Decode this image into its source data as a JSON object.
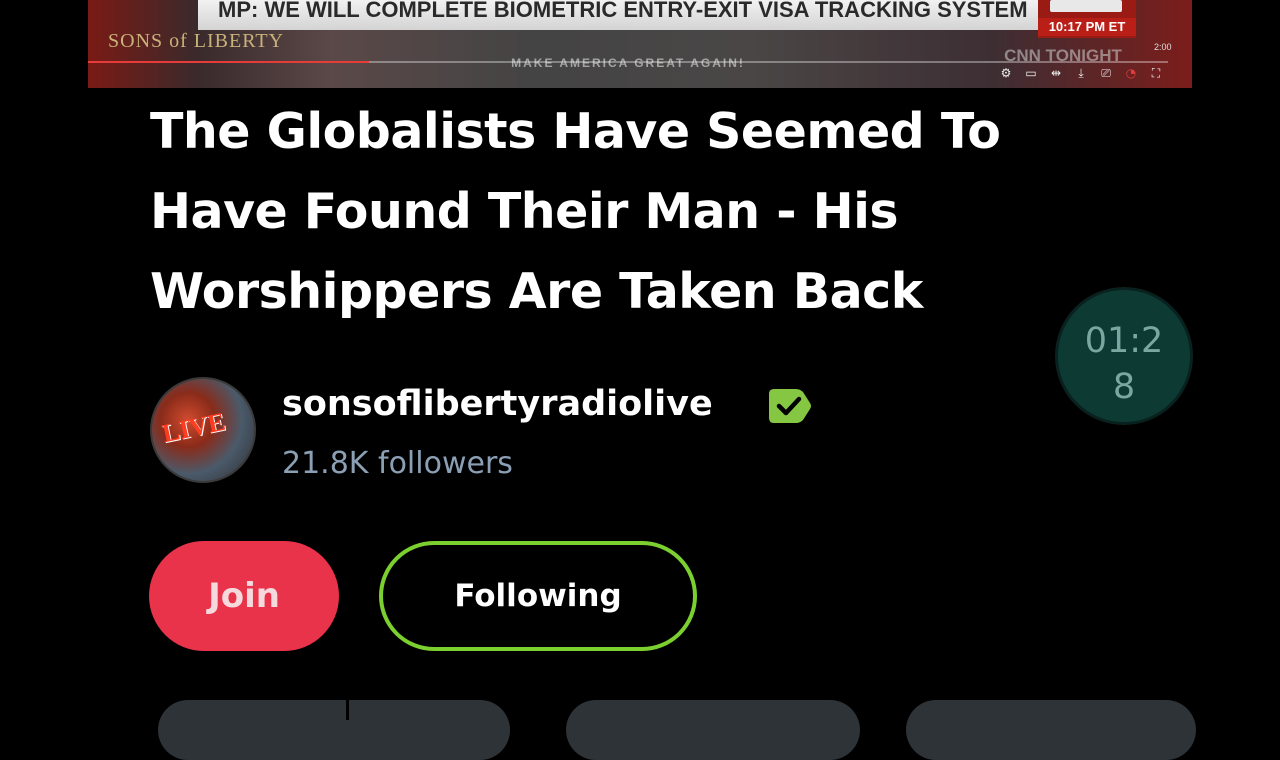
{
  "video": {
    "banner_text": "MP: WE WILL COMPLETE BIOMETRIC ENTRY-EXIT VISA TRACKING SYSTEM",
    "timestamp": "10:17 PM ET",
    "show_name": "CNN TONIGHT",
    "podium_text": "MAKE AMERICA GREAT AGAIN!",
    "channel_logo": "SONS of LIBERTY",
    "duration": "2:00",
    "progress": 0.26
  },
  "title": "The Globalists Have Seemed To Have Found Their Man - His Worshippers Are Taken Back",
  "timer": "01:28",
  "channel": {
    "name": "sonsoflibertyradiolive",
    "followers": "21.8K followers",
    "avatar_text": "LIVE",
    "verified_color": "#85c742"
  },
  "buttons": {
    "join": "Join",
    "following": "Following"
  },
  "colors": {
    "join": "#e8334a",
    "following_border": "#7bcf2e",
    "timer_bg": "#0d3b34",
    "followers_text": "#8ba0b4"
  },
  "icons": {
    "verified": "verified-badge-icon",
    "settings": "gear-icon",
    "cast": "cast-icon",
    "record": "record-icon",
    "fullscreen": "fullscreen-icon"
  }
}
